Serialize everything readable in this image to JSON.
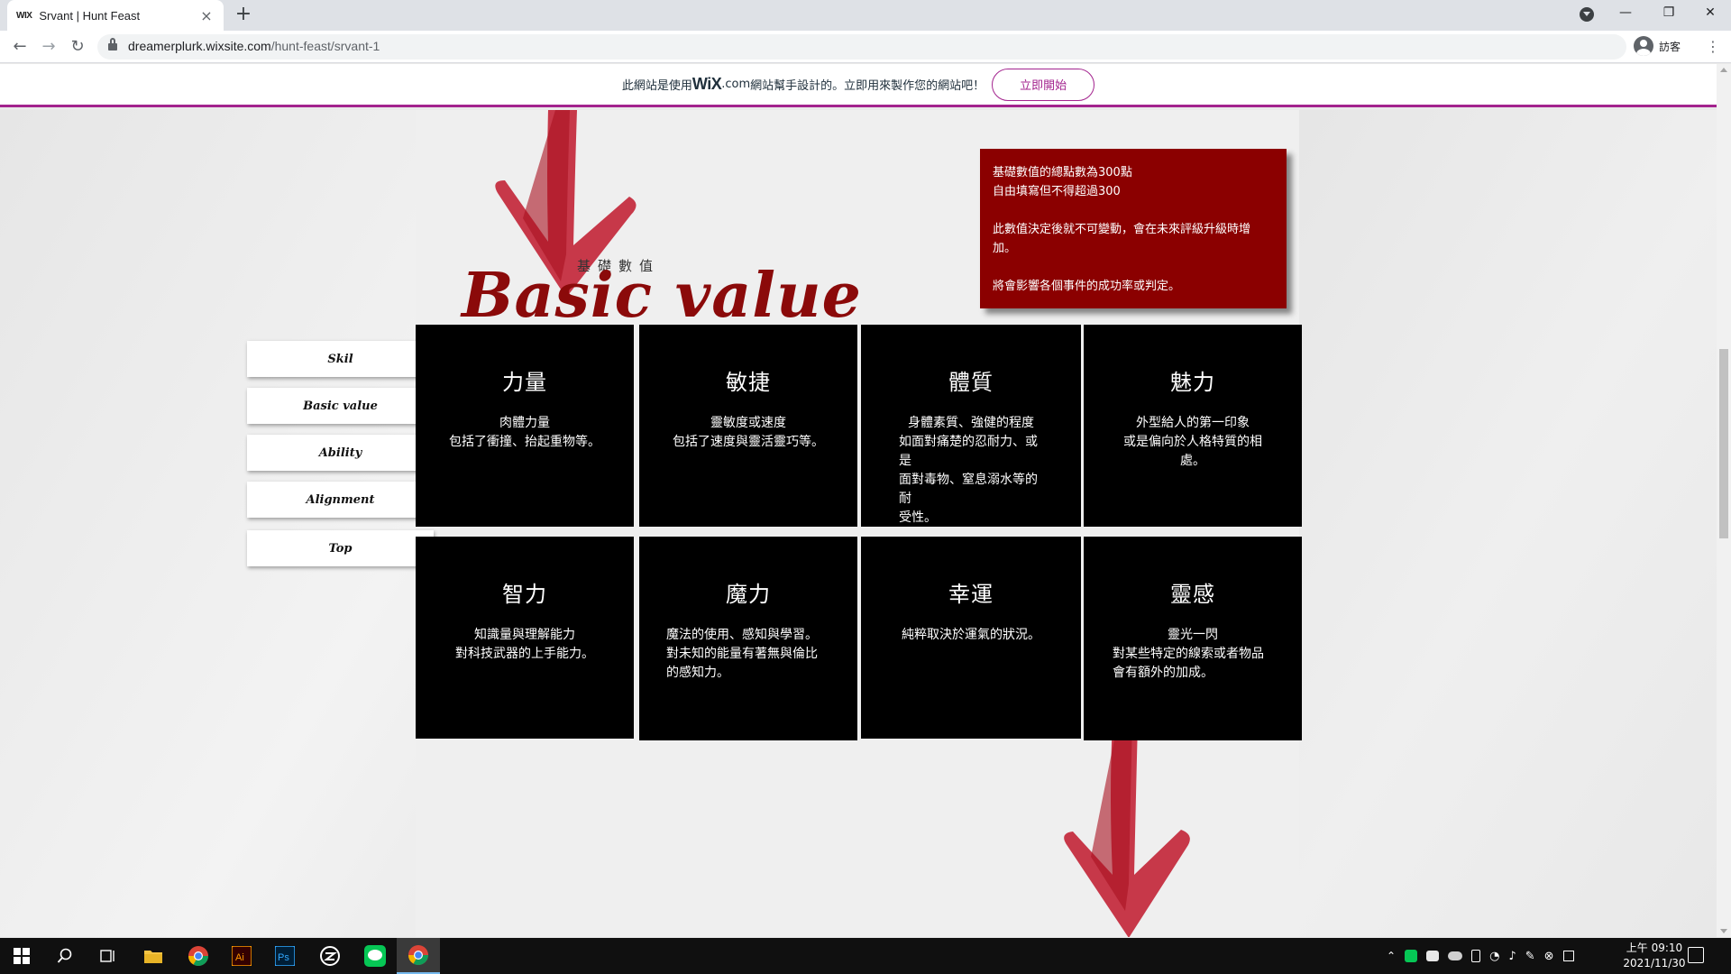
{
  "browser": {
    "tab_favicon": "WIX",
    "tab_title": "Srvant | Hunt Feast",
    "tab_close": "×",
    "new_tab": "+",
    "url_domain": "dreamerplurk.wixsite.com",
    "url_path": "/hunt-feast/srvant-1",
    "profile_label": "訪客",
    "window_minimize": "—",
    "window_restore": "❐",
    "window_close": "✕",
    "back": "←",
    "forward": "→",
    "reload": "↻",
    "menu": "⋮"
  },
  "wix_banner": {
    "text_before": "此網站是使用",
    "brand": "WiX",
    "brand_suffix": ".com",
    "text_after": "網站幫手設計的。立即用來製作您的網站吧！",
    "button_label": "立即開始",
    "accent_color": "#a3238e"
  },
  "header": {
    "subtitle": "基礎數值",
    "title": "Basic value",
    "title_color": "#8b0a0a"
  },
  "info_box": {
    "lines": [
      "基礎數值的總點數為300點",
      "自由填寫但不得超過300",
      "",
      "此數值決定後就不可變動，會在未來評級升級時增",
      "加。",
      "",
      "將會影響各個事件的成功率或判定。"
    ],
    "background": "#8b0000"
  },
  "side_nav": {
    "items": [
      {
        "label": "Skil"
      },
      {
        "label": "Basic value"
      },
      {
        "label": "Ability"
      },
      {
        "label": "Alignment"
      },
      {
        "label": "Top"
      }
    ]
  },
  "stats": [
    {
      "title": "力量",
      "desc": [
        "肉體力量",
        "包括了衝撞、抬起重物等。"
      ]
    },
    {
      "title": "敏捷",
      "desc": [
        "靈敏度或速度",
        "包括了速度與靈活靈巧等。"
      ]
    },
    {
      "title": "體質",
      "desc": [
        "身體素質、強健的程度",
        "如面對痛楚的忍耐力、或是",
        "面對毒物、窒息溺水等的耐",
        "受性。"
      ]
    },
    {
      "title": "魅力",
      "desc": [
        "外型給人的第一印象",
        "或是偏向於人格特質的相處。"
      ]
    },
    {
      "title": "智力",
      "desc": [
        "知識量與理解能力",
        "對科技武器的上手能力。"
      ]
    },
    {
      "title": "魔力",
      "desc": [
        "魔法的使用、感知與學習。",
        "對未知的能量有著無與倫比",
        "的感知力。"
      ]
    },
    {
      "title": "幸運",
      "desc": [
        "純粹取決於運氣的狀況。"
      ]
    },
    {
      "title": "靈感",
      "desc": [
        "靈光一閃",
        "對某些特定的線索或者物品",
        "會有額外的加成。"
      ]
    }
  ],
  "taskbar": {
    "clock_time": "上午 09:10",
    "clock_date": "2021/11/30"
  }
}
